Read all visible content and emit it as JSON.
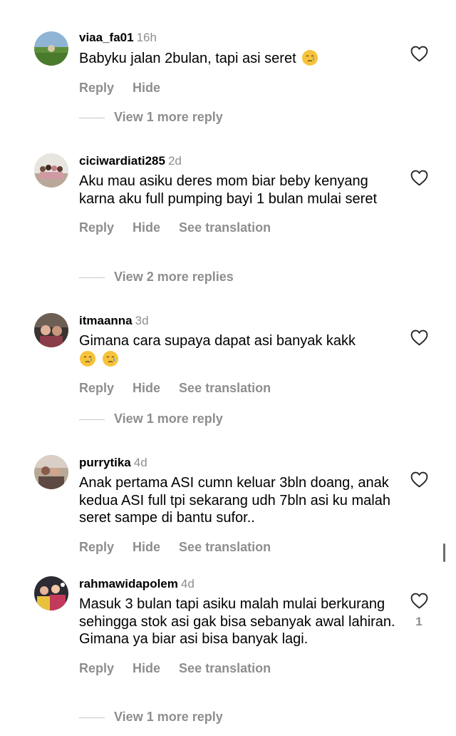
{
  "comments": [
    {
      "username": "viaa_fa01",
      "time": "16h",
      "text": "Babyku jalan 2bulan, tapi asi seret",
      "emojis": 1,
      "actions": {
        "reply": "Reply",
        "hide": "Hide"
      },
      "view_more": "View 1 more reply",
      "likes": ""
    },
    {
      "username": "ciciwardiati285",
      "time": "2d",
      "text": "Aku mau asiku deres mom biar beby kenyang karna aku full pumping bayi 1 bulan mulai seret",
      "emojis": 0,
      "actions": {
        "reply": "Reply",
        "hide": "Hide",
        "translate": "See translation"
      },
      "view_more": "View 2 more replies",
      "likes": ""
    },
    {
      "username": "itmaanna",
      "time": "3d",
      "text": "Gimana cara supaya dapat asi banyak kakk",
      "emojis": 2,
      "actions": {
        "reply": "Reply",
        "hide": "Hide",
        "translate": "See translation"
      },
      "view_more": "View 1 more reply",
      "likes": ""
    },
    {
      "username": "purrytika",
      "time": "4d",
      "text": "Anak pertama ASI cumn keluar 3bln doang, anak kedua ASI full tpi sekarang udh 7bln asi ku malah seret sampe di bantu sufor..",
      "emojis": 0,
      "actions": {
        "reply": "Reply",
        "hide": "Hide",
        "translate": "See translation"
      },
      "view_more": "",
      "likes": ""
    },
    {
      "username": "rahmawidapolem",
      "time": "4d",
      "text": "Masuk 3 bulan tapi asiku malah mulai berkurang sehingga stok asi gak bisa sebanyak awal lahiran. Gimana ya biar asi bisa banyak lagi.",
      "emojis": 0,
      "actions": {
        "reply": "Reply",
        "hide": "Hide",
        "translate": "See translation"
      },
      "view_more": "View 1 more reply",
      "likes": "1"
    }
  ],
  "icons": {
    "like": "heart-outline-icon",
    "emoji": "crying-face-emoji"
  },
  "colors": {
    "secondary_text": "#8e8e8e",
    "divider": "#c7c7c7",
    "emoji_face": "#f7c33b",
    "emoji_tear": "#4aa3e8"
  }
}
